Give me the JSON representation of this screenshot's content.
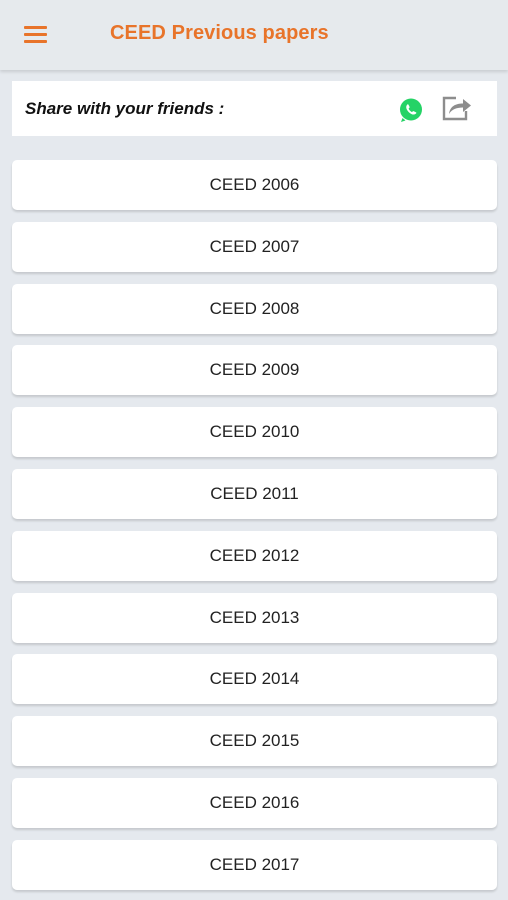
{
  "appbar": {
    "title": "CEED Previous papers"
  },
  "share": {
    "label": "Share with your friends :"
  },
  "papers": [
    "CEED 2006",
    "CEED 2007",
    "CEED 2008",
    "CEED 2009",
    "CEED 2010",
    "CEED 2011",
    "CEED 2012",
    "CEED 2013",
    "CEED 2014",
    "CEED 2015",
    "CEED 2016",
    "CEED 2017"
  ],
  "colors": {
    "accent": "#e8742a",
    "whatsapp": "#25d366"
  },
  "icons": {
    "menu": "hamburger-menu-icon",
    "whatsapp": "whatsapp-icon",
    "share": "share-icon"
  }
}
